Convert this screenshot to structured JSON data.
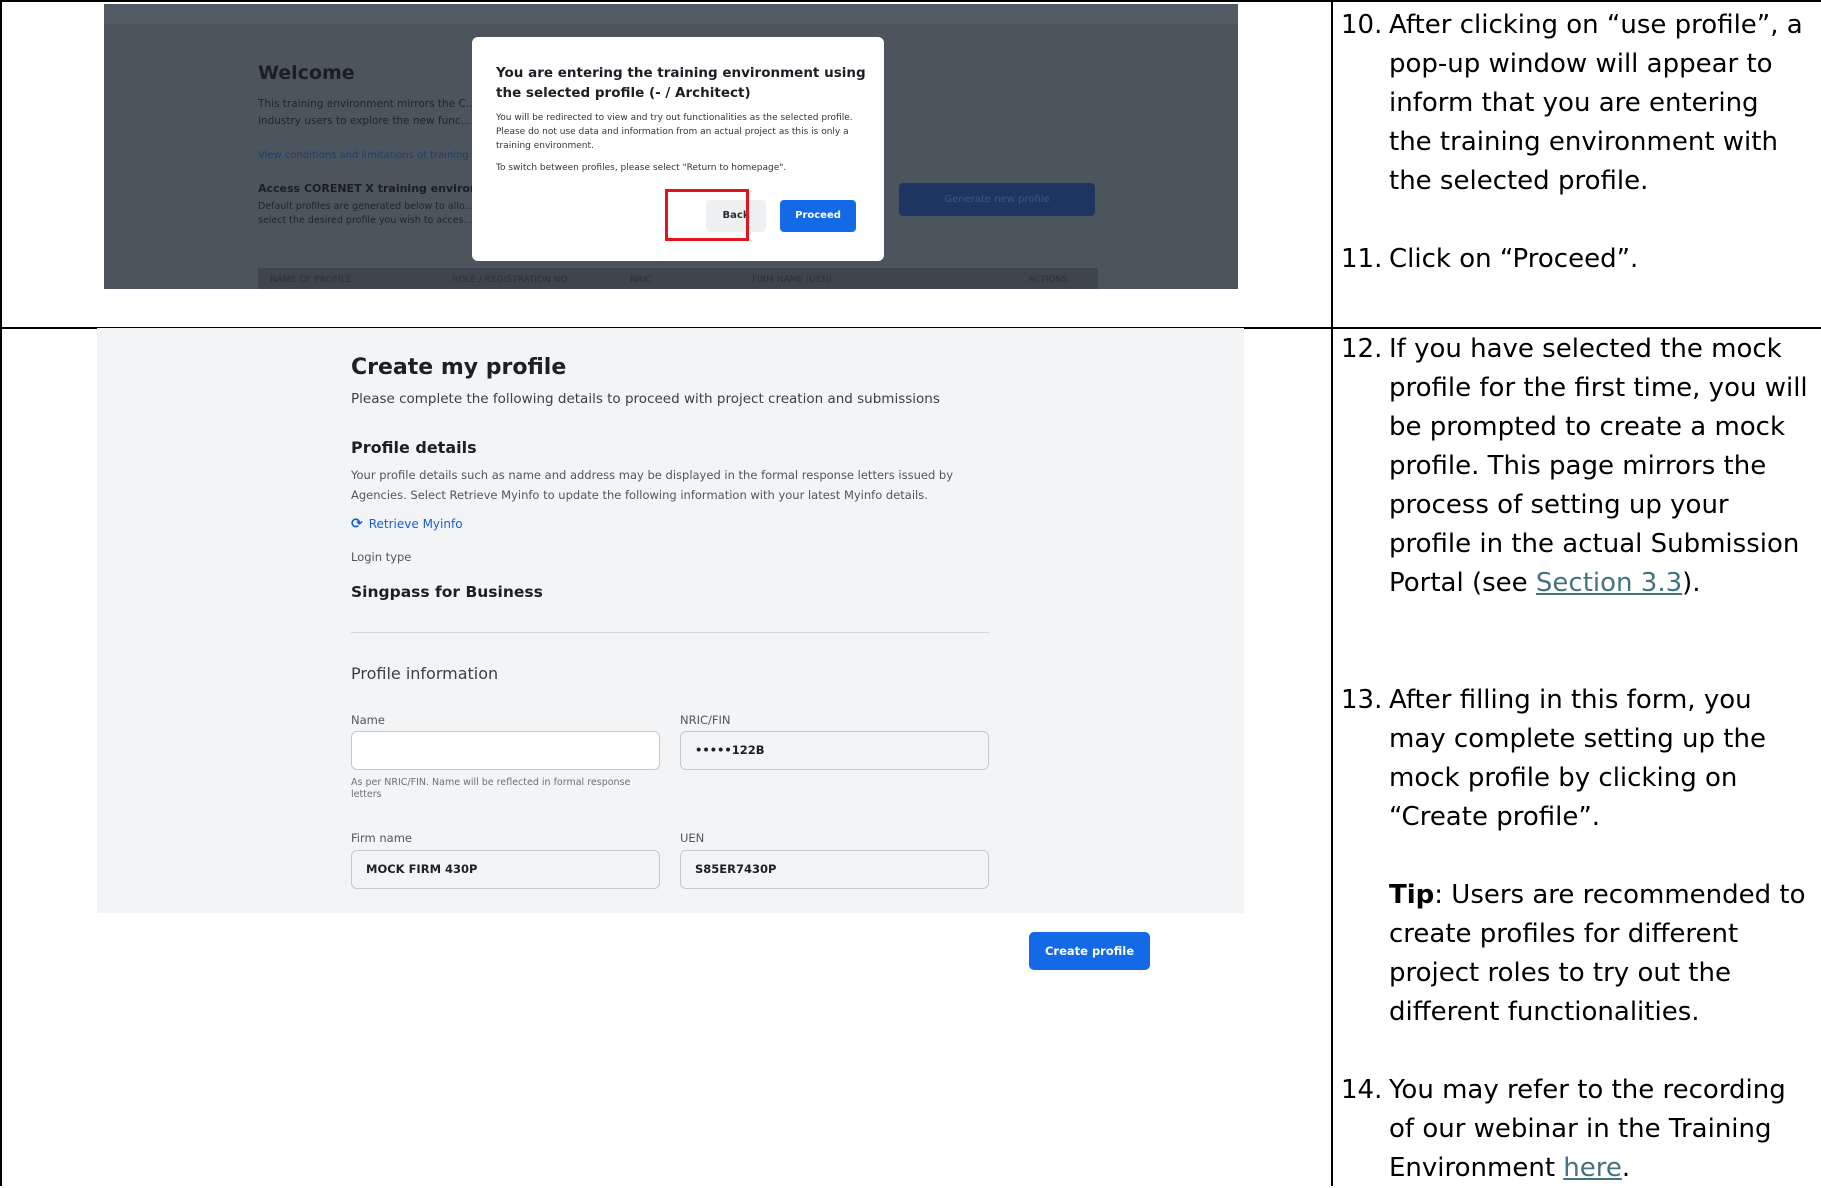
{
  "modal_screenshot": {
    "background": {
      "welcome_title": "Welcome",
      "description": "This training environment mirrors the C... industry users to explore the new func...",
      "conditions_link": "View conditions and limitations of training e...",
      "access_title": "Access CORENET X training environ...",
      "default_profiles_text": "Default profiles are generated below to allo... select the desired profile you wish to acces...",
      "generate_button": "Generate new profile",
      "table_headers": [
        "NAME OF PROFILE",
        "ROLE / REGISTRATION NO.",
        "NRIC",
        "FIRM NAME (UEN)",
        "ACTIONS"
      ]
    },
    "modal": {
      "title": "You are entering the training environment using the selected profile (- / Architect)",
      "body": "You will be redirected to view and try out functionalities as the selected profile. Please do not use data and information from an actual project as this is only a training environment.",
      "switch_text": "To switch between profiles, please select \"Return to homepage\".",
      "back_button": "Back",
      "proceed_button": "Proceed"
    },
    "highlight_color": "#e4141b"
  },
  "create_profile_screenshot": {
    "title": "Create my profile",
    "subtitle": "Please complete the following details to proceed with project creation and submissions",
    "section_title": "Profile details",
    "section_desc": "Your profile details such as name and address may be displayed in the formal response letters issued by Agencies. Select Retrieve Myinfo to update the following information with your latest Myinfo details.",
    "retrieve_link": "Retrieve Myinfo",
    "login_type_label": "Login type",
    "login_type_value": "Singpass for Business",
    "info_title": "Profile information",
    "fields": {
      "name_label": "Name",
      "name_value": "",
      "name_help": "As per NRIC/FIN. Name will be reflected in formal response letters",
      "nric_label": "NRIC/FIN",
      "nric_value": "•••••122B",
      "firm_label": "Firm name",
      "firm_value": "MOCK FIRM 430P",
      "uen_label": "UEN",
      "uen_value": "S85ER7430P"
    },
    "create_button": "Create profile",
    "accent_color": "#1469e6"
  },
  "instructions": {
    "step10": {
      "num": "10.",
      "text": "After clicking on “use profile”, a pop-up window will appear to inform that you are entering the training environment with the selected profile."
    },
    "step11": {
      "num": "11.",
      "text": "Click on “Proceed”."
    },
    "step12": {
      "num": "12.",
      "text": "If you have selected the mock profile for the first time, you will be prompted to create a mock profile. This page mirrors the process of setting up your profile in the actual Submission Portal (see ",
      "link": "Section 3.3",
      "after": ")."
    },
    "step13": {
      "num": "13.",
      "text": "After filling in this form, you may complete setting up the mock profile by clicking on “Create profile”."
    },
    "tip": {
      "label": "Tip",
      "text": ": Users are recommended to create profiles for different project roles to try out the different functionalities."
    },
    "step14": {
      "num": "14.",
      "text": "You may refer to the recording of our webinar in the Training Environment ",
      "link": "here",
      "after": "."
    }
  }
}
